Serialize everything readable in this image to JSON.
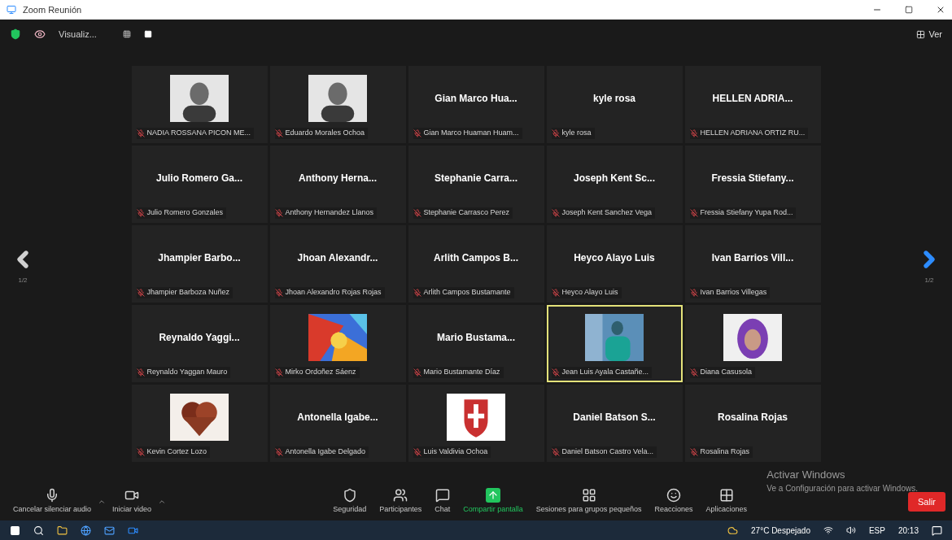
{
  "window": {
    "title": "Zoom Reunión"
  },
  "header": {
    "status": "Visualiz...",
    "view_label": "Ver"
  },
  "pager": {
    "left": "1/2",
    "right": "1/2"
  },
  "tiles": [
    {
      "kind": "picture",
      "label": "NADIA ROSSANA PICON ME...",
      "speaking": false
    },
    {
      "kind": "picture",
      "label": "Eduardo Morales Ochoa",
      "speaking": false
    },
    {
      "kind": "name",
      "display": "Gian Marco Hua...",
      "label": "Gian Marco Huaman Huam...",
      "speaking": false
    },
    {
      "kind": "name",
      "display": "kyle rosa",
      "label": "kyle rosa",
      "speaking": false
    },
    {
      "kind": "name",
      "display": "HELLEN ADRIA...",
      "label": "HELLEN ADRIANA ORTIZ RU...",
      "speaking": false
    },
    {
      "kind": "name",
      "display": "Julio Romero Ga...",
      "label": "Julio Romero Gonzales",
      "speaking": false
    },
    {
      "kind": "name",
      "display": "Anthony Herna...",
      "label": "Anthony Hernandez Llanos",
      "speaking": false
    },
    {
      "kind": "name",
      "display": "Stephanie Carra...",
      "label": "Stephanie Carrasco Perez",
      "speaking": false
    },
    {
      "kind": "name",
      "display": "Joseph Kent Sc...",
      "label": "Joseph Kent Sanchez Vega",
      "speaking": false
    },
    {
      "kind": "name",
      "display": "Fressia Stiefany...",
      "label": "Fressia Stiefany Yupa Rod...",
      "speaking": false
    },
    {
      "kind": "name",
      "display": "Jhampier Barbo...",
      "label": "Jhampier Barboza Nuñez",
      "speaking": false
    },
    {
      "kind": "name",
      "display": "Jhoan Alexandr...",
      "label": "Jhoan Alexandro Rojas Rojas",
      "speaking": false
    },
    {
      "kind": "name",
      "display": "Arlith Campos B...",
      "label": "Arlith Campos Bustamante",
      "speaking": false
    },
    {
      "kind": "name",
      "display": "Heyco Alayo Luis",
      "label": "Heyco Alayo Luis",
      "speaking": false
    },
    {
      "kind": "name",
      "display": "Ivan Barrios Vill...",
      "label": "Ivan Barrios Villegas",
      "speaking": false
    },
    {
      "kind": "name",
      "display": "Reynaldo Yaggi...",
      "label": "Reynaldo Yaggan Mauro",
      "speaking": false
    },
    {
      "kind": "picture",
      "label": "Mirko Ordoñez Sáenz",
      "speaking": false
    },
    {
      "kind": "name",
      "display": "Mario Bustama...",
      "label": "Mario Bustamante Díaz",
      "speaking": false
    },
    {
      "kind": "picture",
      "label": "Jean Luis Ayala Castañe...",
      "speaking": true
    },
    {
      "kind": "picture",
      "label": "Diana Casusola",
      "speaking": false
    },
    {
      "kind": "picture",
      "label": "Kevin Cortez Lozo",
      "speaking": false
    },
    {
      "kind": "name",
      "display": "Antonella Igabe...",
      "label": "Antonella Igabe Delgado",
      "speaking": false
    },
    {
      "kind": "picture",
      "label": "Luis Valdivia Ochoa",
      "speaking": false
    },
    {
      "kind": "name",
      "display": "Daniel Batson S...",
      "label": "Daniel Batson Castro Vela...",
      "speaking": false
    },
    {
      "kind": "name",
      "display": "Rosalina Rojas",
      "label": "Rosalina Rojas",
      "speaking": false
    }
  ],
  "toolbar": {
    "left": [
      {
        "kind": "mic",
        "label": "Cancelar silenciar audio"
      },
      {
        "kind": "video",
        "label": "Iniciar video"
      }
    ],
    "center": [
      {
        "kind": "shield",
        "label": "Seguridad"
      },
      {
        "kind": "people",
        "label": "Participantes"
      },
      {
        "kind": "chat",
        "label": "Chat"
      },
      {
        "kind": "share",
        "label": "Compartir pantalla"
      },
      {
        "kind": "rooms",
        "label": "Sesiones para grupos pequeños"
      },
      {
        "kind": "smile",
        "label": "Reacciones"
      },
      {
        "kind": "apps",
        "label": "Aplicaciones"
      }
    ],
    "leave": "Salir"
  },
  "activation": {
    "title": "Activar Windows",
    "text": "Ve a Configuración para activar Windows."
  },
  "taskbar": {
    "weather": "27°C Despejado",
    "language": "ESP",
    "time": "20:13"
  }
}
